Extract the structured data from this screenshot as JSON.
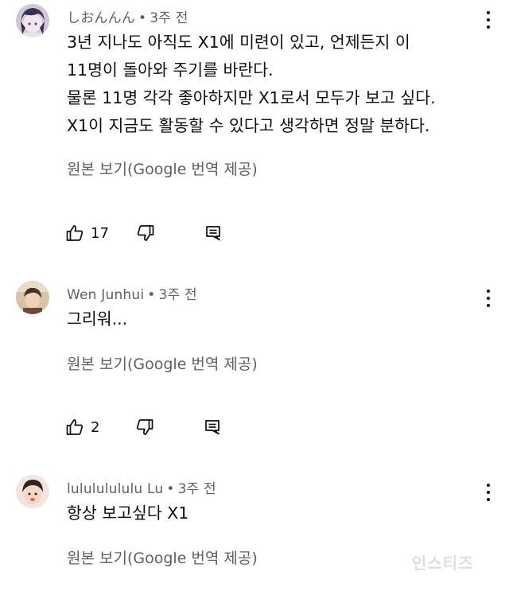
{
  "comments": [
    {
      "author": "しおんんん",
      "time": "3주 전",
      "lines": [
        "3년 지나도 아직도 X1에 미련이 있고, 언제든지 이",
        "11명이 돌아와 주기를 바란다.",
        "물론 11명 각각 좋아하지만 X1로서 모두가 보고 싶다.",
        "X1이 지금도 활동할 수 있다고 생각하면 정말 분하다."
      ],
      "translate_label": "원본 보기(Google 번역 제공)",
      "likes": "17"
    },
    {
      "author": "Wen Junhui",
      "time": "3주 전",
      "lines": [
        "그리워..."
      ],
      "translate_label": "원본 보기(Google 번역 제공)",
      "likes": "2"
    },
    {
      "author": "lulululululu Lu",
      "time": "3주 전",
      "lines": [
        "항상 보고싶다 X1"
      ],
      "translate_label": "원본 보기(Google 번역 제공)"
    }
  ],
  "separator": "•",
  "icons": {
    "like": "thumbs-up-icon",
    "dislike": "thumbs-down-icon",
    "reply": "reply-icon",
    "more": "more-vert-icon"
  },
  "colors": {
    "text_primary": "#0f0f0f",
    "text_secondary": "#606060"
  },
  "watermark": "인스티즈"
}
